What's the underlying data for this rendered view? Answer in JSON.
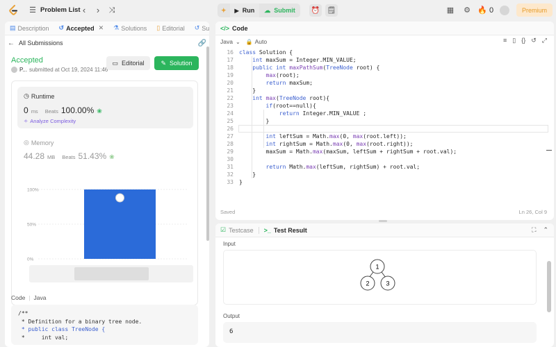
{
  "topbar": {
    "problem_list": "Problem List",
    "run": "Run",
    "submit": "Submit",
    "streak": "0",
    "premium": "Premium"
  },
  "left": {
    "tabs": [
      {
        "label": "Description",
        "icon": "description-icon"
      },
      {
        "label": "Accepted",
        "icon": "history-icon"
      },
      {
        "label": "Solutions",
        "icon": "flask-icon"
      },
      {
        "label": "Editorial",
        "icon": "book-icon"
      },
      {
        "label": "Submi",
        "icon": "history-icon"
      }
    ],
    "all_submissions": "All Submissions",
    "status": "Accepted",
    "user": "P...",
    "submitted": "submitted at Oct 19, 2024 11:46",
    "editorial_btn": "Editorial",
    "solution_btn": "Solution",
    "runtime": {
      "label": "Runtime",
      "value": "0",
      "unit": "ms",
      "beats_label": "Beats",
      "beats": "100.00%"
    },
    "analyze": "Analyze Complexity",
    "memory": {
      "label": "Memory",
      "value": "44.28",
      "unit": "MB",
      "beats_label": "Beats",
      "beats": "51.43%"
    },
    "chart_ticks": [
      "100%",
      "50%",
      "0%"
    ],
    "code_label": "Code",
    "code_lang": "Java",
    "code_lines": [
      "/**",
      " * Definition for a binary tree node.",
      " * public class TreeNode {",
      " *     int val;"
    ]
  },
  "chart_data": {
    "type": "bar",
    "categories": [
      ""
    ],
    "values": [
      100
    ],
    "ylim": [
      0,
      100
    ],
    "yticks": [
      "100%",
      "50%",
      "0%"
    ],
    "color": "#2b6bd9"
  },
  "editor": {
    "title": "Code",
    "language": "Java",
    "mode": "Auto",
    "saved": "Saved",
    "position": "Ln 26, Col 9",
    "lines": [
      {
        "n": "16",
        "t": "class Solution {"
      },
      {
        "n": "17",
        "t": "    int maxSum = Integer.MIN_VALUE;"
      },
      {
        "n": "18",
        "t": "    public int maxPathSum(TreeNode root) {"
      },
      {
        "n": "19",
        "t": "        max(root);"
      },
      {
        "n": "20",
        "t": "        return maxSum;"
      },
      {
        "n": "21",
        "t": "    }"
      },
      {
        "n": "22",
        "t": "    int max(TreeNode root){"
      },
      {
        "n": "23",
        "t": "        if(root==null){"
      },
      {
        "n": "24",
        "t": "            return Integer.MIN_VALUE ;"
      },
      {
        "n": "25",
        "t": "        }"
      },
      {
        "n": "26",
        "t": ""
      },
      {
        "n": "27",
        "t": "        int leftSum = Math.max(0, max(root.left));"
      },
      {
        "n": "28",
        "t": "        int rightSum = Math.max(0, max(root.right));"
      },
      {
        "n": "29",
        "t": "        maxSum = Math.max(maxSum, leftSum + rightSum + root.val);"
      },
      {
        "n": "30",
        "t": ""
      },
      {
        "n": "31",
        "t": "        return Math.max(leftSum, rightSum) + root.val;"
      },
      {
        "n": "32",
        "t": "    }"
      },
      {
        "n": "33",
        "t": "}"
      }
    ]
  },
  "result": {
    "tab_testcase": "Testcase",
    "tab_result": "Test Result",
    "input_label": "Input",
    "tree": {
      "root": "1",
      "left": "2",
      "right": "3"
    },
    "output_label": "Output",
    "output": "6"
  }
}
